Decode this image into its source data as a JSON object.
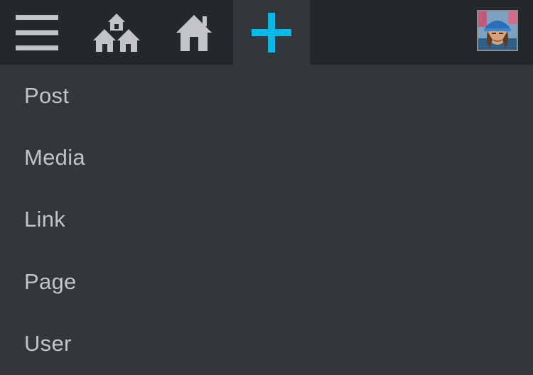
{
  "adminbar": {
    "menu_icon": "hamburger-menu-icon",
    "my_sites_icon": "my-sites-icon",
    "site_home_icon": "home-icon",
    "new_icon": "plus-icon",
    "account_avatar": "user-avatar",
    "colors": {
      "bar_background": "#23282d",
      "icon": "#c3c4c7",
      "accent": "#00b9eb",
      "submenu_background": "#32373c",
      "submenu_text": "#c3c4c7"
    }
  },
  "new_content_menu": {
    "items": [
      {
        "label": "Post"
      },
      {
        "label": "Media"
      },
      {
        "label": "Link"
      },
      {
        "label": "Page"
      },
      {
        "label": "User"
      }
    ]
  }
}
